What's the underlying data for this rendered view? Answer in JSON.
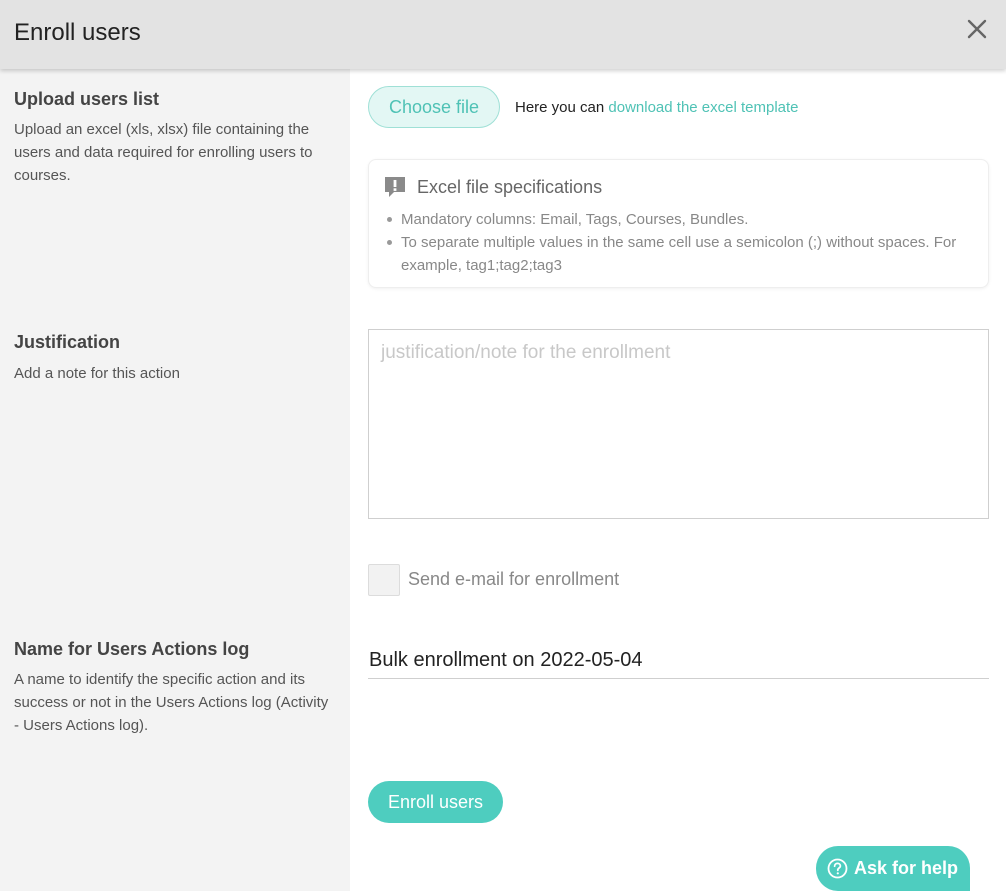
{
  "header": {
    "title": "Enroll users",
    "close_icon": "close-icon"
  },
  "upload": {
    "title": "Upload users list",
    "description": "Upload an excel (xls, xlsx) file containing the users and data required for enrolling users to courses.",
    "choose_file_label": "Choose file",
    "download_prefix": "Here you can",
    "download_link": "download the excel template"
  },
  "spec": {
    "icon": "exclamation-icon",
    "title": "Excel file specifications",
    "items": [
      "Mandatory columns: Email, Tags, Courses, Bundles.",
      "To separate multiple values in the same cell use a semicolon (;) without spaces. For example, tag1;tag2;tag3"
    ]
  },
  "justification": {
    "title": "Justification",
    "description": "Add a note for this action",
    "placeholder": "justification/note for the enrollment",
    "value": ""
  },
  "email_option": {
    "label": "Send e-mail for enrollment",
    "checked": false
  },
  "log": {
    "title": "Name for Users Actions log",
    "description": "A name to identify the specific action and its success or not in the Users Actions log (Activity - Users Actions log).",
    "value": "Bulk enrollment on 2022-05-04"
  },
  "actions": {
    "enroll_label": "Enroll users",
    "help_label": "Ask for help",
    "help_icon": "question-circle-icon"
  },
  "colors": {
    "accent": "#4ecdbf",
    "accent_light": "#e3f7f4",
    "header_bg": "#e3e3e3",
    "left_panel_bg": "#f3f3f3"
  }
}
